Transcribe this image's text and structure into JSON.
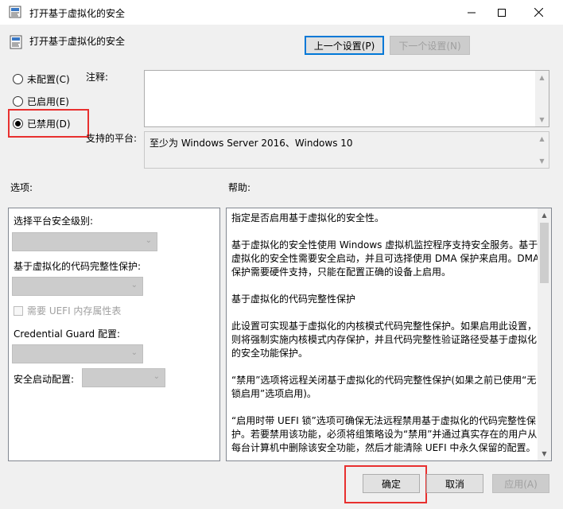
{
  "window": {
    "title": "打开基于虚拟化的安全",
    "minimize_icon": "minimize-icon",
    "maximize_icon": "maximize-icon",
    "close_icon": "close-icon"
  },
  "header": {
    "title": "打开基于虚拟化的安全",
    "prev_setting": "上一个设置(P)",
    "next_setting": "下一个设置(N)"
  },
  "state": {
    "not_configured": "未配置(C)",
    "enabled": "已启用(E)",
    "disabled": "已禁用(D)",
    "selected": "disabled"
  },
  "comment": {
    "label": "注释:",
    "value": ""
  },
  "supported_on": {
    "label": "支持的平台:",
    "value": "至少为 Windows Server 2016、Windows 10"
  },
  "options": {
    "label": "选项:",
    "platform_security_label": "选择平台安全级别:",
    "vbs_code_integrity_label": "基于虚拟化的代码完整性保护:",
    "uefi_checkbox_label": "需要 UEFI 内存属性表",
    "credential_guard_label": "Credential Guard 配置:",
    "secure_launch_label": "安全启动配置:"
  },
  "help": {
    "label": "帮助:",
    "paragraphs": [
      "指定是否启用基于虚拟化的安全性。",
      "基于虚拟化的安全性使用 Windows 虚拟机监控程序支持安全服务。基于虚拟化的安全性需要安全启动，并且可选择使用 DMA 保护来启用。DMA 保护需要硬件支持，只能在配置正确的设备上启用。",
      "基于虚拟化的代码完整性保护",
      "此设置可实现基于虚拟化的内核模式代码完整性保护。如果启用此设置，则将强制实施内核模式内存保护，并且代码完整性验证路径受基于虚拟化的安全功能保护。",
      "“禁用”选项将远程关闭基于虚拟化的代码完整性保护(如果之前已使用“无锁启用”选项启用)。",
      "“启用时带 UEFI 锁”选项可确保无法远程禁用基于虚拟化的代码完整性保护。若要禁用该功能，必须将组策略设为“禁用”并通过真实存在的用户从每台计算机中删除该安全功能，然后才能清除 UEFI 中永久保留的配置。"
    ]
  },
  "footer": {
    "ok": "确定",
    "cancel": "取消",
    "apply": "应用(A)"
  },
  "colors": {
    "highlight": "#e8302f",
    "default_button_border": "#0078d7"
  }
}
